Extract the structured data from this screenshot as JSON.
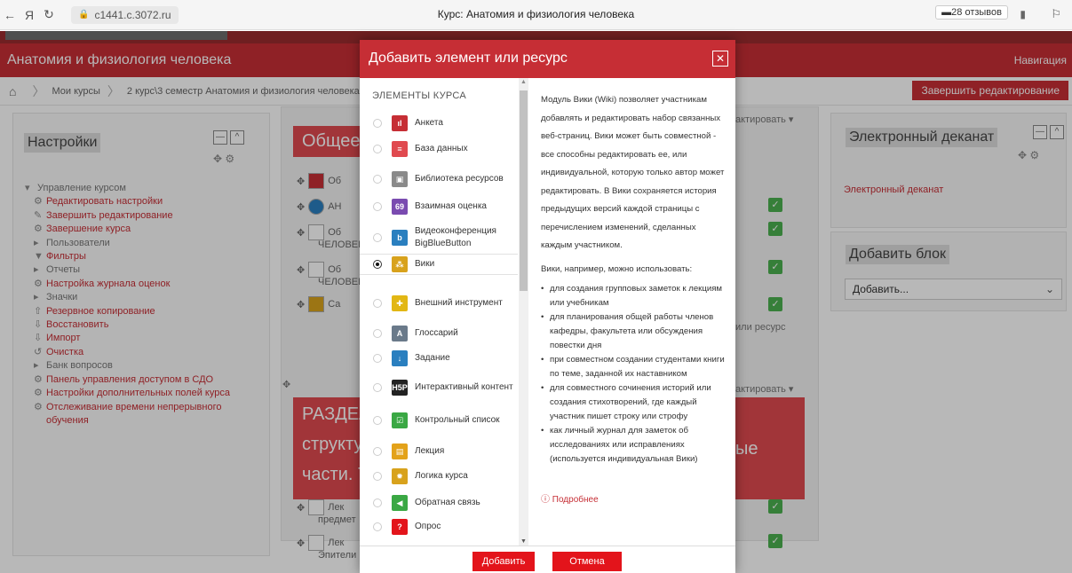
{
  "browser": {
    "back": "←",
    "ya": "Я",
    "reload": "↻",
    "url": "c1441.c.3072.ru",
    "title": "Курс: Анатомия и физиология человека",
    "reviews": "28 отзывов"
  },
  "header": {
    "course_title": "Анатомия и физиология человека",
    "nav_label": "Навигация"
  },
  "breadcrumb": {
    "items": [
      "Мои курсы",
      "2 курс\\3 семестр Анатомия и физиология человека"
    ]
  },
  "finish_edit_label": "Завершить редактирование",
  "settings_block": {
    "title": "Настройки",
    "items": [
      "Управление курсом",
      "Редактировать настройки",
      "Завершить редактирование",
      "Завершение курса",
      "Пользователи",
      "Фильтры",
      "Отчеты",
      "Настройка журнала оценок",
      "Значки",
      "Резервное копирование",
      "Восстановить",
      "Импорт",
      "Очистка",
      "Банк вопросов",
      "Панель управления доступом в СДО",
      "Настройки дополнительных полей курса",
      "Отслеживание времени непрерывного",
      "обучения"
    ]
  },
  "center": {
    "section1": "Общее",
    "section2_lines": [
      "РАЗДЕЛ",
      "структу",
      "части. Т"
    ],
    "section2_right": "ые",
    "edit_label": "актировать",
    "add_resource": "или ресурс",
    "rows": [
      "Об",
      "АН",
      "Об",
      "ЧЕЛОВЕК",
      "Об",
      "ЧЕЛОВЕК",
      "Са",
      "Лек",
      "предмет",
      "Лек",
      "Эпители"
    ]
  },
  "right_blocks": {
    "dean_title": "Электронный деканат",
    "dean_link": "Электронный деканат",
    "add_block_title": "Добавить блок",
    "add_select": "Добавить..."
  },
  "modal": {
    "title": "Добавить элемент или ресурс",
    "section_header": "ЭЛЕМЕНТЫ КУРСА",
    "options": [
      {
        "label": "Анкета",
        "icon": "survey-icon",
        "color": "#c62e35"
      },
      {
        "label": "База данных",
        "icon": "database-icon",
        "color": "#e04a4f"
      },
      {
        "label": "Библиотека ресурсов",
        "icon": "library-icon",
        "color": "#8a8a8a"
      },
      {
        "label": "Взаимная оценка",
        "icon": "workshop-icon",
        "color": "#7a4bb0"
      },
      {
        "label": "Видеоконференция BigBlueButton",
        "icon": "bigbluebutton-icon",
        "color": "#2a7fbf"
      },
      {
        "label": "Вики",
        "icon": "wiki-icon",
        "color": "#d8a21c"
      },
      {
        "label": "Внешний инструмент",
        "icon": "lti-icon",
        "color": "#e2b714"
      },
      {
        "label": "Глоссарий",
        "icon": "glossary-icon",
        "color": "#6a7a8a"
      },
      {
        "label": "Задание",
        "icon": "assignment-icon",
        "color": "#2a7fbf"
      },
      {
        "label": "Интерактивный контент",
        "icon": "h5p-icon",
        "color": "#222222"
      },
      {
        "label": "Контрольный список",
        "icon": "checklist-icon",
        "color": "#3aa844"
      },
      {
        "label": "Лекция",
        "icon": "lesson-icon",
        "color": "#e3a21a"
      },
      {
        "label": "Логика курса",
        "icon": "gear-icon",
        "color": "#d8a21c"
      },
      {
        "label": "Обратная связь",
        "icon": "feedback-icon",
        "color": "#3aa844"
      },
      {
        "label": "Опрос",
        "icon": "choice-icon",
        "color": "#e3141b"
      }
    ],
    "selected_index": 5,
    "description": {
      "intro": "Модуль Вики (Wiki) позволяет участникам добавлять и редактировать набор связанных веб-страниц. Вики может быть совместной - все способны редактировать ее, или индивидуальной, которую только автор может редактировать. В Вики сохраняется история предыдущих версий каждой страницы с перечислением изменений, сделанных каждым участником.",
      "usage_intro": "Вики, например, можно использовать:",
      "usages": [
        "для создания групповых заметок к лекциям или учебникам",
        "для планирования общей работы членов кафедры, факультета или обсуждения повестки дня",
        "при совместном создании студентами книги по теме, заданной их наставником",
        "для совместного сочинения историй или создания стихотворений, где каждый участник пишет строку или строфу",
        "как личный журнал для заметок об исследованиях или исправлениях (используется индивидуальная Вики)"
      ],
      "more": "Подробнее"
    },
    "add_button": "Добавить",
    "cancel_button": "Отмена"
  }
}
